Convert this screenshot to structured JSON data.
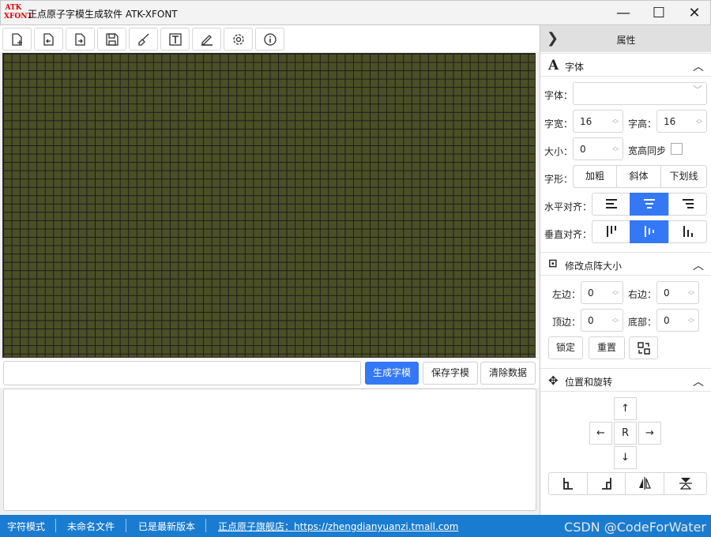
{
  "window": {
    "logo_line1": "ATK",
    "logo_line2": "XFONT",
    "title": "正点原子字模生成软件 ATK-XFONT",
    "minimize": "—",
    "maximize": "☐",
    "close": "✕"
  },
  "toolbar": {
    "buttons": [
      "new-file-icon",
      "open-file-icon",
      "export-file-icon",
      "save-icon",
      "brush-icon",
      "text-icon",
      "pen-icon",
      "settings-icon",
      "info-icon"
    ]
  },
  "grid": {
    "color": "#4b4f26",
    "line_color": "#1b1b1b"
  },
  "actions": {
    "input_value": "",
    "generate": "生成字模",
    "save": "保存字模",
    "clear": "清除数据"
  },
  "status": {
    "mode": "字符模式",
    "file": "未命名文件",
    "version": "已是最新版本",
    "store": "正点原子旗舰店：https://zhengdianyuanzi.tmall.com",
    "watermark": "CSDN @CodeForWater"
  },
  "panel": {
    "title": "属性",
    "font_section": {
      "title": "字体",
      "font_label": "字体：",
      "font_value": "",
      "width_label": "字宽：",
      "width_value": "16",
      "height_label": "字高：",
      "height_value": "16",
      "size_label": "大小：",
      "size_value": "0",
      "sync_label": "宽高同步",
      "style_label": "字形：",
      "bold": "加粗",
      "italic": "斜体",
      "underline": "下划线",
      "halign_label": "水平对齐：",
      "valign_label": "垂直对齐："
    },
    "matrix_section": {
      "title": "修改点阵大小",
      "left_label": "左边：",
      "left_value": "0",
      "right_label": "右边：",
      "right_value": "0",
      "top_label": "顶边：",
      "top_value": "0",
      "bottom_label": "底部：",
      "bottom_value": "0",
      "lock": "锁定",
      "reset": "重置"
    },
    "position_section": {
      "title": "位置和旋转",
      "up": "↑",
      "left": "←",
      "center": "R",
      "right": "→",
      "down": "↓"
    }
  }
}
